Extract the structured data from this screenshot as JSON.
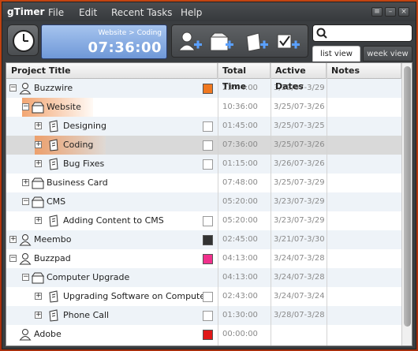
{
  "app": {
    "title": "gTimer"
  },
  "menu": [
    "File",
    "Edit",
    "Recent Tasks",
    "Help"
  ],
  "timer": {
    "task": "Website > Coding",
    "time": "07:36:00"
  },
  "search": {
    "value": "",
    "placeholder": ""
  },
  "tabs": {
    "list": "list view",
    "week": "week view"
  },
  "columns": {
    "project": "Project Title",
    "total": "Total Time",
    "active": "Active Dates",
    "notes": "Notes"
  },
  "colors": {
    "orange": "#f07820",
    "dark": "#333333",
    "pink": "#f0308c",
    "red": "#e01818",
    "none": "#ffffff"
  },
  "rows": [
    {
      "title": "Buzzwire",
      "total": "23:44:00",
      "dates": "3/22/07-3/29",
      "icon": "person-icon",
      "color": "orange",
      "level": 0,
      "expander": "minus"
    },
    {
      "title": "Website",
      "total": "10:36:00",
      "dates": "3/25/07-3/26",
      "icon": "folder-icon",
      "color": null,
      "level": 1,
      "expander": "minus"
    },
    {
      "title": "Designing",
      "total": "01:45:00",
      "dates": "3/25/07-3/25",
      "icon": "task-icon",
      "color": "none",
      "level": 2,
      "expander": "plus"
    },
    {
      "title": "Coding",
      "total": "07:36:00",
      "dates": "3/25/07-3/26",
      "icon": "task-icon",
      "color": "none",
      "level": 2,
      "expander": "plus"
    },
    {
      "title": "Bug Fixes",
      "total": "01:15:00",
      "dates": "3/26/07-3/26",
      "icon": "task-icon",
      "color": "none",
      "level": 2,
      "expander": "plus"
    },
    {
      "title": "Business Card",
      "total": "07:48:00",
      "dates": "3/25/07-3/29",
      "icon": "folder-icon",
      "color": null,
      "level": 1,
      "expander": "plus"
    },
    {
      "title": "CMS",
      "total": "05:20:00",
      "dates": "3/23/07-3/29",
      "icon": "folder-icon",
      "color": null,
      "level": 1,
      "expander": "minus"
    },
    {
      "title": "Adding Content to CMS",
      "total": "05:20:00",
      "dates": "3/23/07-3/29",
      "icon": "task-icon",
      "color": "none",
      "level": 2,
      "expander": "plus"
    },
    {
      "title": "Meembo",
      "total": "02:45:00",
      "dates": "3/21/07-3/30",
      "icon": "person-icon",
      "color": "dark",
      "level": 0,
      "expander": "plus"
    },
    {
      "title": "Buzzpad",
      "total": "04:13:00",
      "dates": "3/24/07-3/28",
      "icon": "person-icon",
      "color": "pink",
      "level": 0,
      "expander": "minus"
    },
    {
      "title": "Computer Upgrade",
      "total": "04:13:00",
      "dates": "3/24/07-3/28",
      "icon": "folder-icon",
      "color": null,
      "level": 1,
      "expander": "minus"
    },
    {
      "title": "Upgrading Software on Computers",
      "total": "02:43:00",
      "dates": "3/24/07-3/24",
      "icon": "task-icon",
      "color": "none",
      "level": 2,
      "expander": "plus"
    },
    {
      "title": "Phone Call",
      "total": "01:30:00",
      "dates": "3/28/07-3/28",
      "icon": "task-icon",
      "color": "none",
      "level": 2,
      "expander": "plus"
    },
    {
      "title": "Adobe",
      "total": "00:00:00",
      "dates": "",
      "icon": "person-icon",
      "color": "red",
      "level": 0,
      "expander": "none"
    }
  ]
}
